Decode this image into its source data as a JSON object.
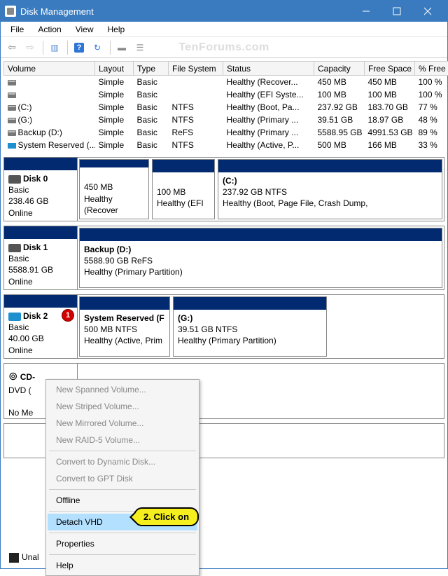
{
  "window": {
    "title": "Disk Management"
  },
  "menu": {
    "file": "File",
    "action": "Action",
    "view": "View",
    "help": "Help"
  },
  "watermark": "TenForums.com",
  "columns": {
    "volume": "Volume",
    "layout": "Layout",
    "type": "Type",
    "filesystem": "File System",
    "status": "Status",
    "capacity": "Capacity",
    "freespace": "Free Space",
    "pctfree": "% Free"
  },
  "volumes": [
    {
      "name": "",
      "layout": "Simple",
      "type": "Basic",
      "fs": "",
      "status": "Healthy (Recover...",
      "cap": "450 MB",
      "free": "450 MB",
      "pct": "100 %"
    },
    {
      "name": "",
      "layout": "Simple",
      "type": "Basic",
      "fs": "",
      "status": "Healthy (EFI Syste...",
      "cap": "100 MB",
      "free": "100 MB",
      "pct": "100 %"
    },
    {
      "name": "(C:)",
      "layout": "Simple",
      "type": "Basic",
      "fs": "NTFS",
      "status": "Healthy (Boot, Pa...",
      "cap": "237.92 GB",
      "free": "183.70 GB",
      "pct": "77 %"
    },
    {
      "name": "(G:)",
      "layout": "Simple",
      "type": "Basic",
      "fs": "NTFS",
      "status": "Healthy (Primary ...",
      "cap": "39.51 GB",
      "free": "18.97 GB",
      "pct": "48 %"
    },
    {
      "name": "Backup (D:)",
      "layout": "Simple",
      "type": "Basic",
      "fs": "ReFS",
      "status": "Healthy (Primary ...",
      "cap": "5588.95 GB",
      "free": "4991.53 GB",
      "pct": "89 %"
    },
    {
      "name": "System Reserved (...",
      "layout": "Simple",
      "type": "Basic",
      "fs": "NTFS",
      "status": "Healthy (Active, P...",
      "cap": "500 MB",
      "free": "166 MB",
      "pct": "33 %"
    }
  ],
  "disks": {
    "d0": {
      "label": "Disk 0",
      "type": "Basic",
      "size": "238.46 GB",
      "state": "Online",
      "p0": {
        "title": "",
        "l1": "450 MB",
        "l2": "Healthy (Recover"
      },
      "p1": {
        "title": "",
        "l1": "100 MB",
        "l2": "Healthy (EFI"
      },
      "p2": {
        "title": "(C:)",
        "l1": "237.92 GB NTFS",
        "l2": "Healthy (Boot, Page File, Crash Dump,"
      }
    },
    "d1": {
      "label": "Disk 1",
      "type": "Basic",
      "size": "5588.91 GB",
      "state": "Online",
      "p0": {
        "title": "Backup  (D:)",
        "l1": "5588.90 GB ReFS",
        "l2": "Healthy (Primary Partition)"
      }
    },
    "d2": {
      "label": "Disk 2",
      "type": "Basic",
      "size": "40.00 GB",
      "state": "Online",
      "p0": {
        "title": "System Reserved  (F",
        "l1": "500 MB NTFS",
        "l2": "Healthy (Active, Prim"
      },
      "p1": {
        "title": "(G:)",
        "l1": "39.51 GB NTFS",
        "l2": "Healthy (Primary Partition)"
      }
    },
    "cd": {
      "label": "CD-",
      "type": "DVD (",
      "nomedia": "No Me"
    }
  },
  "ctx": {
    "spanned": "New Spanned Volume...",
    "striped": "New Striped Volume...",
    "mirrored": "New Mirrored Volume...",
    "raid5": "New RAID-5 Volume...",
    "dyn": "Convert to Dynamic Disk...",
    "gpt": "Convert to GPT Disk",
    "offline": "Offline",
    "detach": "Detach VHD",
    "props": "Properties",
    "help": "Help"
  },
  "annot": {
    "num": "1",
    "callout": "2. Click on"
  },
  "legend": {
    "unallocated": "Unal"
  }
}
